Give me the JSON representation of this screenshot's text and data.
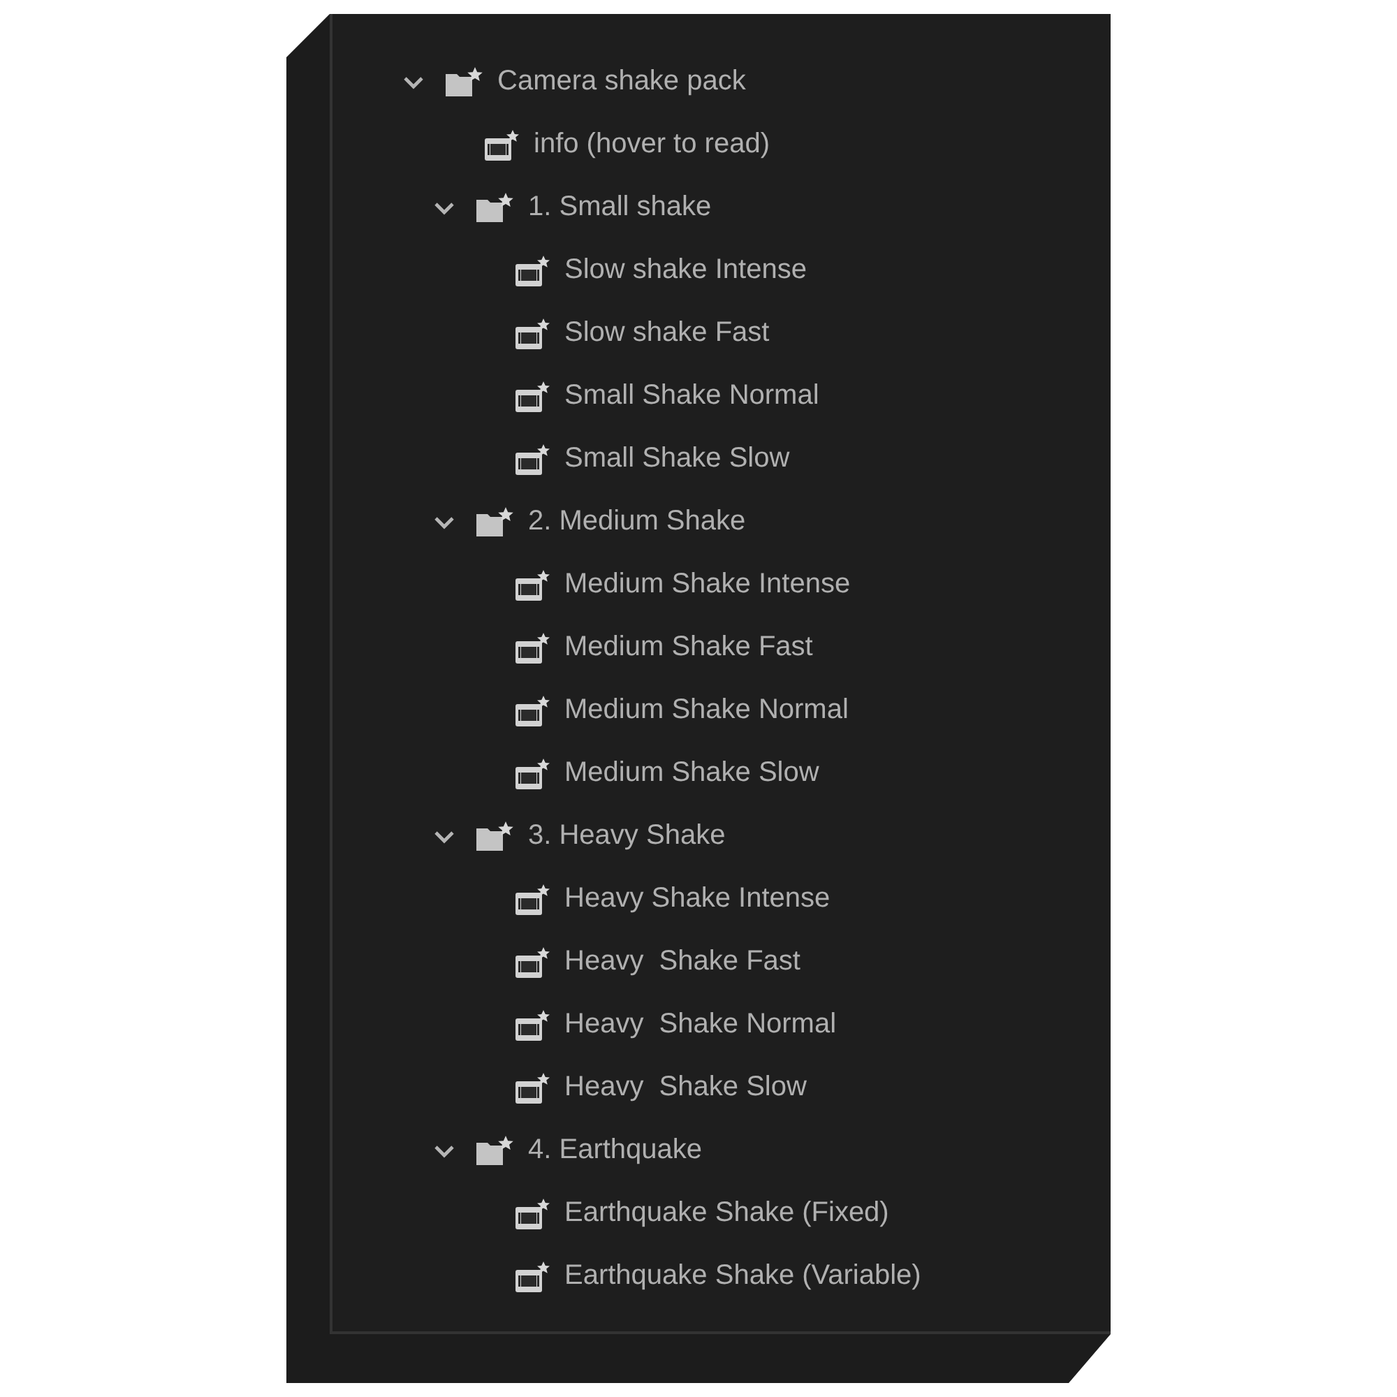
{
  "tree": {
    "items": [
      {
        "kind": "folder",
        "label": "Camera shake pack",
        "expanded": true,
        "children": [
          {
            "kind": "clip",
            "label": "info (hover to read)"
          },
          {
            "kind": "folder",
            "label": "1. Small shake",
            "expanded": true,
            "children": [
              {
                "kind": "clip",
                "label": "Slow shake Intense"
              },
              {
                "kind": "clip",
                "label": "Slow shake Fast"
              },
              {
                "kind": "clip",
                "label": "Small Shake Normal"
              },
              {
                "kind": "clip",
                "label": "Small Shake Slow"
              }
            ]
          },
          {
            "kind": "folder",
            "label": "2. Medium Shake",
            "expanded": true,
            "children": [
              {
                "kind": "clip",
                "label": "Medium Shake Intense"
              },
              {
                "kind": "clip",
                "label": "Medium Shake Fast"
              },
              {
                "kind": "clip",
                "label": "Medium Shake Normal"
              },
              {
                "kind": "clip",
                "label": "Medium Shake Slow"
              }
            ]
          },
          {
            "kind": "folder",
            "label": "3. Heavy Shake",
            "expanded": true,
            "children": [
              {
                "kind": "clip",
                "label": "Heavy Shake Intense"
              },
              {
                "kind": "clip",
                "label": "Heavy  Shake Fast"
              },
              {
                "kind": "clip",
                "label": "Heavy  Shake Normal"
              },
              {
                "kind": "clip",
                "label": "Heavy  Shake Slow"
              }
            ]
          },
          {
            "kind": "folder",
            "label": "4. Earthquake",
            "expanded": true,
            "children": [
              {
                "kind": "clip",
                "label": "Earthquake Shake (Fixed)"
              },
              {
                "kind": "clip",
                "label": "Earthquake Shake (Variable)"
              }
            ]
          }
        ]
      }
    ]
  }
}
